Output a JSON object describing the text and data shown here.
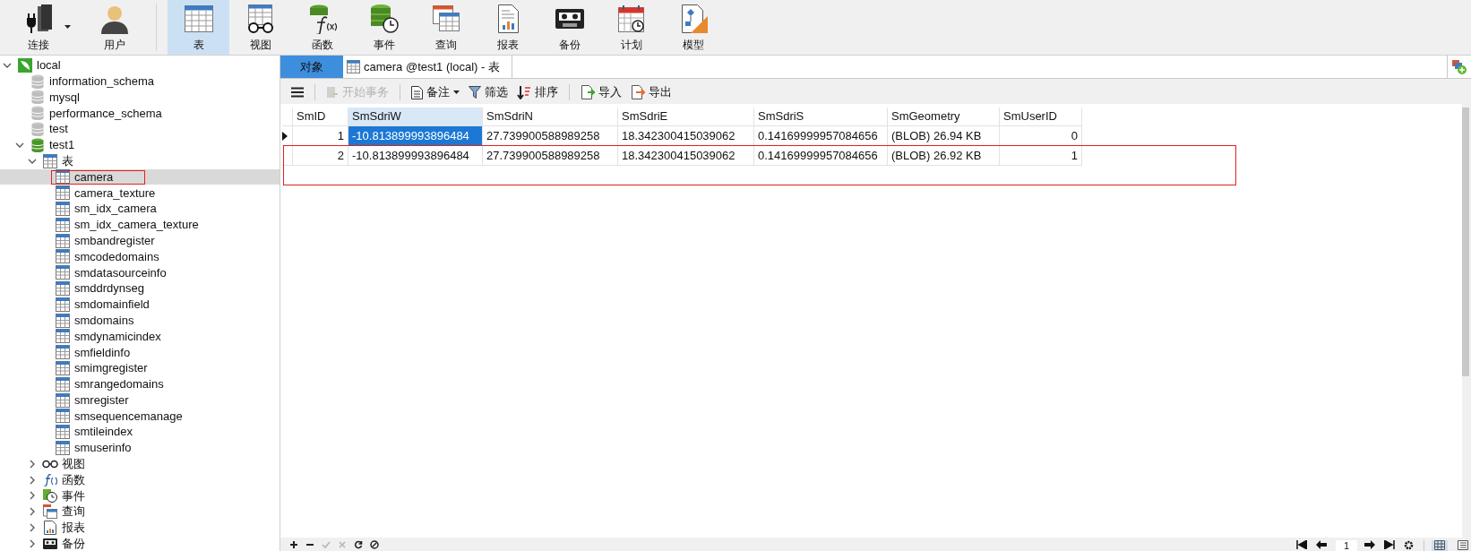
{
  "toolbar": [
    {
      "label": "连接",
      "kind": "connection",
      "selected": false,
      "dropdown": true
    },
    {
      "label": "用户",
      "kind": "user",
      "selected": false,
      "dropdown": false
    },
    {
      "label": "表",
      "kind": "table",
      "selected": true,
      "dropdown": false
    },
    {
      "label": "视图",
      "kind": "view",
      "selected": false,
      "dropdown": false
    },
    {
      "label": "函数",
      "kind": "function",
      "selected": false,
      "dropdown": false
    },
    {
      "label": "事件",
      "kind": "event",
      "selected": false,
      "dropdown": false
    },
    {
      "label": "查询",
      "kind": "query",
      "selected": false,
      "dropdown": false
    },
    {
      "label": "报表",
      "kind": "report",
      "selected": false,
      "dropdown": false
    },
    {
      "label": "备份",
      "kind": "backup",
      "selected": false,
      "dropdown": false
    },
    {
      "label": "计划",
      "kind": "schedule",
      "selected": false,
      "dropdown": false
    },
    {
      "label": "模型",
      "kind": "model",
      "selected": false,
      "dropdown": false
    }
  ],
  "sidebar": {
    "tree": [
      {
        "label": "local",
        "kind": "server",
        "expanded": true,
        "selected": false,
        "marked": false,
        "children": [
          {
            "label": "information_schema",
            "kind": "db",
            "selected": false,
            "marked": false
          },
          {
            "label": "mysql",
            "kind": "db",
            "selected": false,
            "marked": false
          },
          {
            "label": "performance_schema",
            "kind": "db",
            "selected": false,
            "marked": false
          },
          {
            "label": "test",
            "kind": "db",
            "selected": false,
            "marked": false
          },
          {
            "label": "test1",
            "kind": "db-open",
            "expanded": true,
            "selected": false,
            "marked": false,
            "children": [
              {
                "label": "表",
                "kind": "table",
                "expanded": true,
                "selected": false,
                "marked": false,
                "children": [
                  {
                    "label": "camera",
                    "kind": "table",
                    "selected": true,
                    "marked": true
                  },
                  {
                    "label": "camera_texture",
                    "kind": "table",
                    "selected": false,
                    "marked": false
                  },
                  {
                    "label": "sm_idx_camera",
                    "kind": "table",
                    "selected": false,
                    "marked": false
                  },
                  {
                    "label": "sm_idx_camera_texture",
                    "kind": "table",
                    "selected": false,
                    "marked": false
                  },
                  {
                    "label": "smbandregister",
                    "kind": "table",
                    "selected": false,
                    "marked": false
                  },
                  {
                    "label": "smcodedomains",
                    "kind": "table",
                    "selected": false,
                    "marked": false
                  },
                  {
                    "label": "smdatasourceinfo",
                    "kind": "table",
                    "selected": false,
                    "marked": false
                  },
                  {
                    "label": "smddrdynseg",
                    "kind": "table",
                    "selected": false,
                    "marked": false
                  },
                  {
                    "label": "smdomainfield",
                    "kind": "table",
                    "selected": false,
                    "marked": false
                  },
                  {
                    "label": "smdomains",
                    "kind": "table",
                    "selected": false,
                    "marked": false
                  },
                  {
                    "label": "smdynamicindex",
                    "kind": "table",
                    "selected": false,
                    "marked": false
                  },
                  {
                    "label": "smfieldinfo",
                    "kind": "table",
                    "selected": false,
                    "marked": false
                  },
                  {
                    "label": "smimgregister",
                    "kind": "table",
                    "selected": false,
                    "marked": false
                  },
                  {
                    "label": "smrangedomains",
                    "kind": "table",
                    "selected": false,
                    "marked": false
                  },
                  {
                    "label": "smregister",
                    "kind": "table",
                    "selected": false,
                    "marked": false
                  },
                  {
                    "label": "smsequencemanage",
                    "kind": "table",
                    "selected": false,
                    "marked": false
                  },
                  {
                    "label": "smtileindex",
                    "kind": "table",
                    "selected": false,
                    "marked": false
                  },
                  {
                    "label": "smuserinfo",
                    "kind": "table",
                    "selected": false,
                    "marked": false
                  }
                ]
              },
              {
                "label": "视图",
                "kind": "view",
                "expanded": false,
                "selected": false,
                "marked": false
              },
              {
                "label": "函数",
                "kind": "function",
                "expanded": false,
                "selected": false,
                "marked": false
              },
              {
                "label": "事件",
                "kind": "event",
                "expanded": false,
                "selected": false,
                "marked": false
              },
              {
                "label": "查询",
                "kind": "query",
                "expanded": false,
                "selected": false,
                "marked": false
              },
              {
                "label": "报表",
                "kind": "report",
                "expanded": false,
                "selected": false,
                "marked": false
              },
              {
                "label": "备份",
                "kind": "backup",
                "expanded": false,
                "selected": false,
                "marked": false
              }
            ]
          }
        ]
      }
    ]
  },
  "tabs": [
    {
      "label": "对象",
      "kind": "objects",
      "selected": false
    },
    {
      "label": "camera @test1 (local) - 表",
      "kind": "table",
      "selected": true
    }
  ],
  "actions": [
    {
      "kind": "menu",
      "disabled": false,
      "dropdown": false
    },
    {
      "kind": "begin",
      "label": "开始事务",
      "disabled": true,
      "dropdown": false
    },
    {
      "kind": "note",
      "label": "备注",
      "disabled": false,
      "dropdown": true
    },
    {
      "kind": "filter",
      "label": "筛选",
      "disabled": false,
      "dropdown": false
    },
    {
      "kind": "sort",
      "label": "排序",
      "disabled": false,
      "dropdown": false
    },
    {
      "kind": "import",
      "label": "导入",
      "disabled": false,
      "dropdown": false
    },
    {
      "kind": "export",
      "label": "导出",
      "disabled": false,
      "dropdown": false
    }
  ],
  "table": {
    "columns": [
      {
        "label": "SmID",
        "kind": "number",
        "selected": false
      },
      {
        "label": "SmSdriW",
        "kind": "text",
        "selected": true
      },
      {
        "label": "SmSdriN",
        "kind": "text",
        "selected": false
      },
      {
        "label": "SmSdriE",
        "kind": "text",
        "selected": false
      },
      {
        "label": "SmSdriS",
        "kind": "text",
        "selected": false
      },
      {
        "label": "SmGeometry",
        "kind": "text",
        "selected": false
      },
      {
        "label": "SmUserID",
        "kind": "number",
        "selected": false
      }
    ],
    "rows": [
      {
        "current": true,
        "marked": false,
        "cells": [
          {
            "text": "1",
            "selected": false
          },
          {
            "text": "-10.813899993896484",
            "selected": true
          },
          {
            "text": "27.739900588989258",
            "selected": false
          },
          {
            "text": "18.342300415039062",
            "selected": false
          },
          {
            "text": "0.14169999957084656",
            "selected": false
          },
          {
            "text": "(BLOB) 26.94 KB",
            "selected": false
          },
          {
            "text": "0",
            "selected": false
          }
        ]
      },
      {
        "current": false,
        "marked": true,
        "cells": [
          {
            "text": "2",
            "selected": false
          },
          {
            "text": "-10.813899993896484",
            "selected": false
          },
          {
            "text": "27.739900588989258",
            "selected": false
          },
          {
            "text": "18.342300415039062",
            "selected": false
          },
          {
            "text": "0.14169999957084656",
            "selected": false
          },
          {
            "text": "(BLOB) 26.92 KB",
            "selected": false
          },
          {
            "text": "1",
            "selected": false
          }
        ]
      }
    ]
  },
  "bottom_bar": {
    "edit_buttons": [
      {
        "kind": "add",
        "disabled": false
      },
      {
        "kind": "remove",
        "disabled": false
      },
      {
        "kind": "apply",
        "disabled": true
      },
      {
        "kind": "discard",
        "disabled": true
      },
      {
        "kind": "refresh",
        "disabled": false
      },
      {
        "kind": "stop",
        "disabled": false
      }
    ],
    "page": "1",
    "views": [
      {
        "kind": "grid",
        "selected": true
      },
      {
        "kind": "form",
        "selected": false
      }
    ]
  }
}
